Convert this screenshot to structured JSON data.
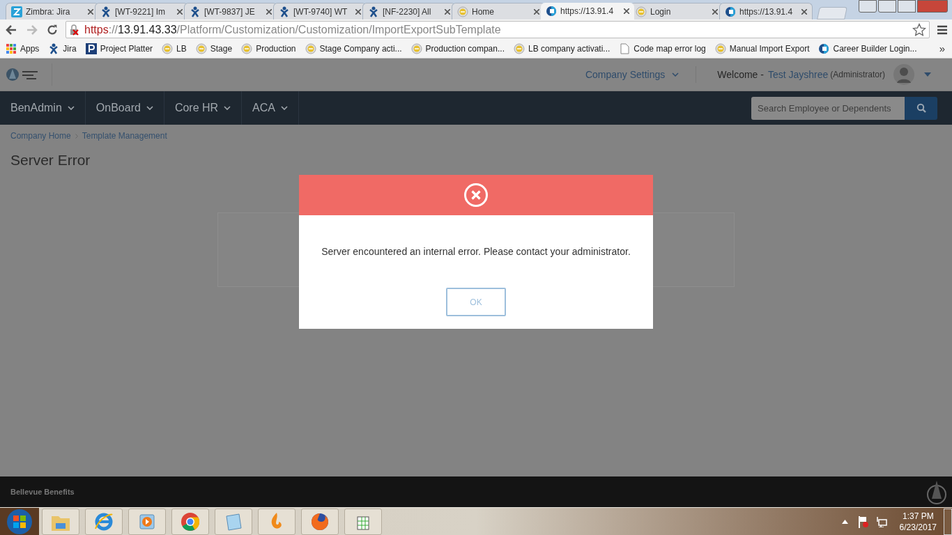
{
  "browser": {
    "tabs": [
      {
        "kind": "z",
        "title": "Zimbra: Jira",
        "selected": false
      },
      {
        "kind": "jira",
        "title": "[WT-9221] Im",
        "selected": false
      },
      {
        "kind": "jira",
        "title": "[WT-9837] JE",
        "selected": false
      },
      {
        "kind": "jira",
        "title": "[WT-9740] WT",
        "selected": false
      },
      {
        "kind": "jira",
        "title": "[NF-2230] All",
        "selected": false
      },
      {
        "kind": "badge",
        "title": "Home",
        "selected": false
      },
      {
        "kind": "site",
        "title": "https://13.91.4",
        "selected": true
      },
      {
        "kind": "badge",
        "title": "Login",
        "selected": false
      },
      {
        "kind": "site",
        "title": "https://13.91.4",
        "selected": false
      }
    ],
    "address": {
      "scheme": "https",
      "separator": "://",
      "host": "13.91.43.33",
      "path": "/Platform/Customization/Customization/ImportExportSubTemplate",
      "insecure": true
    },
    "bookmarks": [
      {
        "kind": "apps",
        "label": "Apps"
      },
      {
        "kind": "jira",
        "label": "Jira"
      },
      {
        "kind": "p",
        "label": "Project Platter"
      },
      {
        "kind": "badge",
        "label": "LB"
      },
      {
        "kind": "badge",
        "label": "Stage"
      },
      {
        "kind": "badge",
        "label": "Production"
      },
      {
        "kind": "badge",
        "label": "Stage Company acti..."
      },
      {
        "kind": "badge",
        "label": "Production compan..."
      },
      {
        "kind": "badge",
        "label": "LB company activati..."
      },
      {
        "kind": "page",
        "label": "Code map error log"
      },
      {
        "kind": "badge",
        "label": "Manual Import Export"
      },
      {
        "kind": "site",
        "label": "Career Builder Login..."
      }
    ],
    "more": "»"
  },
  "app": {
    "header": {
      "company_settings": "Company Settings",
      "welcome": "Welcome -",
      "user_name": "Test Jayshree",
      "role": "(Administrator)"
    },
    "nav": [
      "BenAdmin",
      "OnBoard",
      "Core HR",
      "ACA"
    ],
    "search": {
      "placeholder": "Search Employee or Dependents"
    },
    "breadcrumb": [
      "Company Home",
      "Template Management"
    ],
    "page_title": "Server Error",
    "dialog": {
      "message": "Server encountered an internal error. Please contact your administrator.",
      "button": "OK"
    },
    "footer": "Bellevue Benefits"
  },
  "taskbar": {
    "time": "1:37 PM",
    "date": "6/23/2017"
  }
}
